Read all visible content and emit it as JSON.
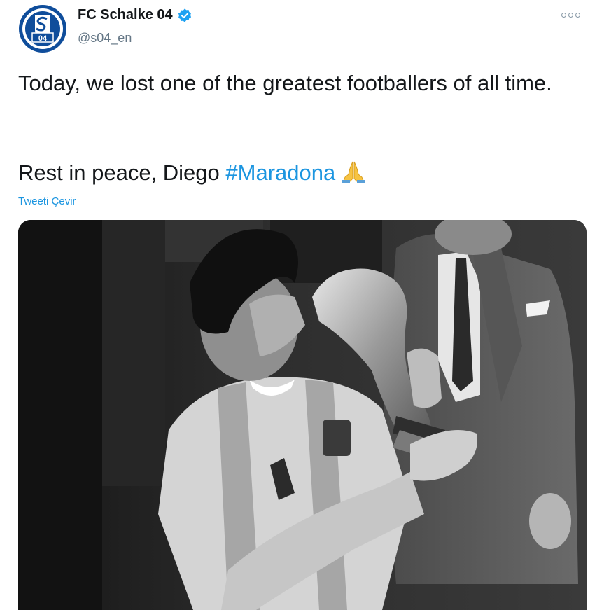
{
  "account": {
    "display_name": "FC Schalke 04",
    "handle": "@s04_en",
    "verified": true,
    "avatar_icon": "schalke-04-logo-icon",
    "brand_color": "#0f4d9b"
  },
  "tweet": {
    "line1": "Today, we lost one of the greatest footballers of all time.",
    "line2_prefix": "Rest in peace, Diego ",
    "hashtag": "#Maradona",
    "emoji_icon": "folded-hands-emoji",
    "translate_label": "Tweeti Çevir"
  },
  "colors": {
    "text": "#14171a",
    "secondary": "#657786",
    "link": "#1b95e0"
  },
  "media": {
    "type": "photo",
    "style": "black-and-white",
    "subject": "player-kissing-trophy"
  }
}
